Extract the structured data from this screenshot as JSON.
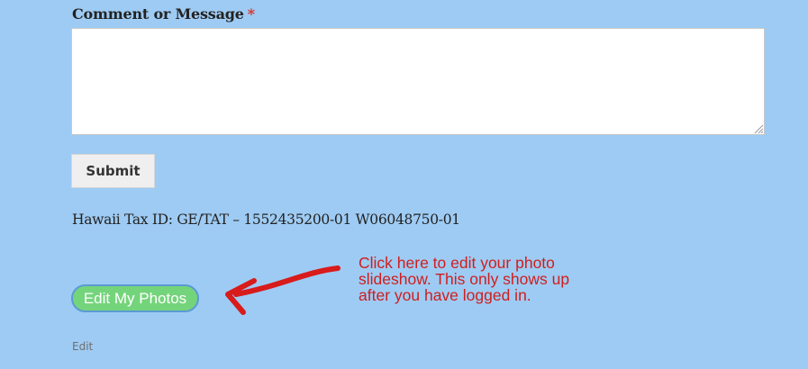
{
  "form": {
    "comment_label": "Comment or Message",
    "required_marker": "*",
    "message_value": "",
    "submit_label": "Submit"
  },
  "tax_id": "Hawaii Tax ID: GE/TAT – 1552435200-01 W06048750-01",
  "photos": {
    "edit_button_label": "Edit My Photos"
  },
  "annotation": {
    "lines": [
      "Click here to edit your photo",
      "slideshow. This only shows up",
      "after you have logged in."
    ],
    "color": "#cf1e1e"
  },
  "footer": {
    "edit_link": "Edit"
  },
  "colors": {
    "background": "#9ecbf3",
    "edit_button": "#74d47b",
    "required": "#d93025"
  }
}
